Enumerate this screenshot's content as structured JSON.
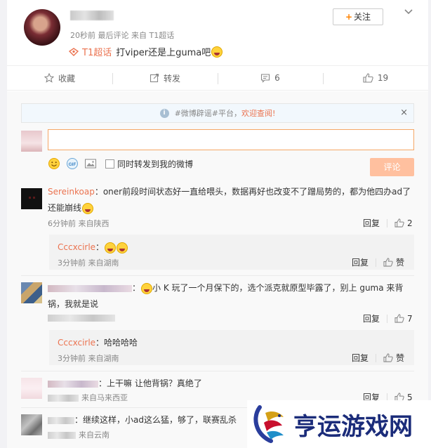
{
  "post": {
    "time": "20秒前",
    "meta_sep": "最后评论",
    "source": "来自 T1超话",
    "follow_label": "关注",
    "topic": "T1超话",
    "text": "打viper还是上guma吧"
  },
  "actions": {
    "favorite": "收藏",
    "repost": "转发",
    "comment_count": "6",
    "like_count": "19"
  },
  "notice": {
    "hashtag": "#微博辟谣#平台，",
    "link": "欢迎查阅!",
    "close": "×"
  },
  "compose": {
    "input_value": "",
    "repost_label": "同时转发到我的微博",
    "submit_label": "评论"
  },
  "comments": [
    {
      "name": "Sereinkoap",
      "line1": "：oner前段时间状态好一直给喂头，数据再好也改变不了蹭局势的，都为他四办ad了",
      "line2": "还能崩线",
      "meta": "6分钟前 来自陕西",
      "reply": "回复",
      "likes": "2",
      "sub": {
        "name": "Cccxcirle",
        "sep": "：",
        "meta": "3分钟前 来自湖南",
        "reply": "回复",
        "likes": "赞"
      }
    },
    {
      "line1": "小 K 玩了一个月保下的，选个派克就原型毕露了，别上 guma 来背",
      "line2": "锅，我就是说",
      "reply": "回复",
      "likes": "7",
      "sub": {
        "name": "Cccxcirle",
        "text": "：哈哈哈哈",
        "meta": "3分钟前 来自湖南",
        "reply": "回复",
        "likes": "赞"
      }
    },
    {
      "line1": "：上干嘛 让他背锅？真绝了",
      "meta": "来自马来西亚",
      "reply": "回复",
      "likes": "5"
    },
    {
      "line1": "：继续这样，小ad这么猛，够了，联赛乱杀",
      "meta": "来自云南"
    }
  ],
  "watermark": {
    "text": "亨运游戏网"
  },
  "colors": {
    "accent": "#eb7350",
    "follow_plus": "#ff8200",
    "input_border": "#f5a766",
    "submit_bg": "#ffc09f",
    "watermark": "#1b2c7a"
  }
}
